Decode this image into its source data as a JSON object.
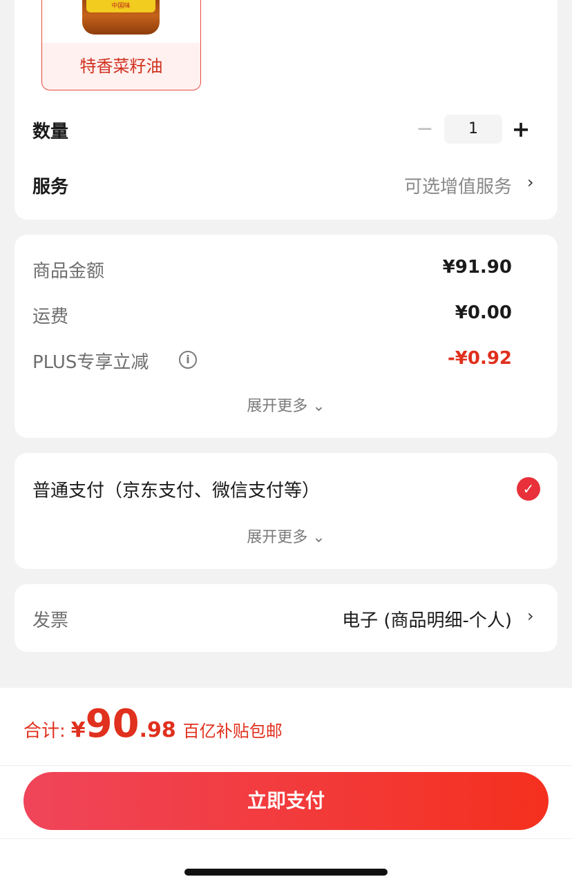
{
  "product": {
    "variant_label": "特香菜籽油",
    "bottle_label": "中国味"
  },
  "quantity": {
    "label": "数量",
    "minus": "−",
    "value": "1",
    "plus": "+"
  },
  "service": {
    "label": "服务",
    "value": "可选增值服务",
    "chevron": "›"
  },
  "price_detail": {
    "rows": [
      {
        "label": "商品金额",
        "value": "¥91.90"
      },
      {
        "label": "运费",
        "value": "¥0.00"
      },
      {
        "label": "PLUS专享立减",
        "value": "-¥0.92"
      }
    ],
    "info_icon": "i",
    "expand_label": "展开更多 ⌄"
  },
  "payment": {
    "method": "普通支付（京东支付、微信支付等）",
    "check": "✓",
    "expand_label": "展开更多 ⌄"
  },
  "invoice": {
    "label": "发票",
    "value": "电子 (商品明细-个人)",
    "chevron": "›"
  },
  "total": {
    "label": "合计:",
    "currency": "¥",
    "amount_int": "90",
    "amount_dec": ".98",
    "note": "百亿补贴包邮"
  },
  "pay_button": {
    "label": "立即支付"
  },
  "colors": {
    "accent_red": "#e0301e",
    "button_gradient_start": "#f0455a",
    "button_gradient_end": "#f5301e",
    "background": "#f2f2f2"
  }
}
